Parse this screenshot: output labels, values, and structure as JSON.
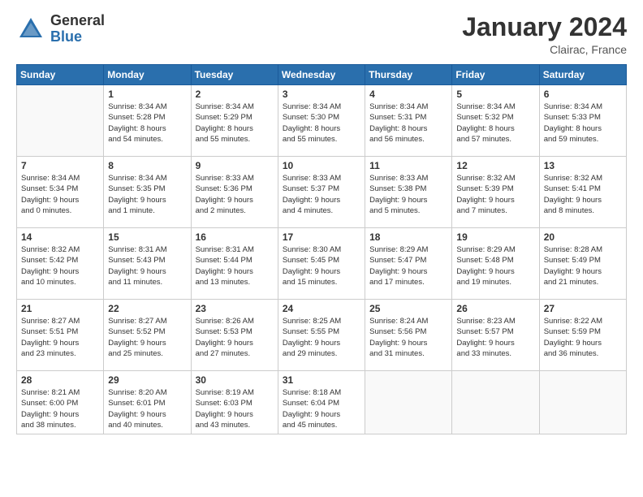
{
  "header": {
    "logo_general": "General",
    "logo_blue": "Blue",
    "month_title": "January 2024",
    "location": "Clairac, France"
  },
  "days_of_week": [
    "Sunday",
    "Monday",
    "Tuesday",
    "Wednesday",
    "Thursday",
    "Friday",
    "Saturday"
  ],
  "weeks": [
    [
      {
        "day": "",
        "info": ""
      },
      {
        "day": "1",
        "info": "Sunrise: 8:34 AM\nSunset: 5:28 PM\nDaylight: 8 hours\nand 54 minutes."
      },
      {
        "day": "2",
        "info": "Sunrise: 8:34 AM\nSunset: 5:29 PM\nDaylight: 8 hours\nand 55 minutes."
      },
      {
        "day": "3",
        "info": "Sunrise: 8:34 AM\nSunset: 5:30 PM\nDaylight: 8 hours\nand 55 minutes."
      },
      {
        "day": "4",
        "info": "Sunrise: 8:34 AM\nSunset: 5:31 PM\nDaylight: 8 hours\nand 56 minutes."
      },
      {
        "day": "5",
        "info": "Sunrise: 8:34 AM\nSunset: 5:32 PM\nDaylight: 8 hours\nand 57 minutes."
      },
      {
        "day": "6",
        "info": "Sunrise: 8:34 AM\nSunset: 5:33 PM\nDaylight: 8 hours\nand 59 minutes."
      }
    ],
    [
      {
        "day": "7",
        "info": "Sunrise: 8:34 AM\nSunset: 5:34 PM\nDaylight: 9 hours\nand 0 minutes."
      },
      {
        "day": "8",
        "info": "Sunrise: 8:34 AM\nSunset: 5:35 PM\nDaylight: 9 hours\nand 1 minute."
      },
      {
        "day": "9",
        "info": "Sunrise: 8:33 AM\nSunset: 5:36 PM\nDaylight: 9 hours\nand 2 minutes."
      },
      {
        "day": "10",
        "info": "Sunrise: 8:33 AM\nSunset: 5:37 PM\nDaylight: 9 hours\nand 4 minutes."
      },
      {
        "day": "11",
        "info": "Sunrise: 8:33 AM\nSunset: 5:38 PM\nDaylight: 9 hours\nand 5 minutes."
      },
      {
        "day": "12",
        "info": "Sunrise: 8:32 AM\nSunset: 5:39 PM\nDaylight: 9 hours\nand 7 minutes."
      },
      {
        "day": "13",
        "info": "Sunrise: 8:32 AM\nSunset: 5:41 PM\nDaylight: 9 hours\nand 8 minutes."
      }
    ],
    [
      {
        "day": "14",
        "info": "Sunrise: 8:32 AM\nSunset: 5:42 PM\nDaylight: 9 hours\nand 10 minutes."
      },
      {
        "day": "15",
        "info": "Sunrise: 8:31 AM\nSunset: 5:43 PM\nDaylight: 9 hours\nand 11 minutes."
      },
      {
        "day": "16",
        "info": "Sunrise: 8:31 AM\nSunset: 5:44 PM\nDaylight: 9 hours\nand 13 minutes."
      },
      {
        "day": "17",
        "info": "Sunrise: 8:30 AM\nSunset: 5:45 PM\nDaylight: 9 hours\nand 15 minutes."
      },
      {
        "day": "18",
        "info": "Sunrise: 8:29 AM\nSunset: 5:47 PM\nDaylight: 9 hours\nand 17 minutes."
      },
      {
        "day": "19",
        "info": "Sunrise: 8:29 AM\nSunset: 5:48 PM\nDaylight: 9 hours\nand 19 minutes."
      },
      {
        "day": "20",
        "info": "Sunrise: 8:28 AM\nSunset: 5:49 PM\nDaylight: 9 hours\nand 21 minutes."
      }
    ],
    [
      {
        "day": "21",
        "info": "Sunrise: 8:27 AM\nSunset: 5:51 PM\nDaylight: 9 hours\nand 23 minutes."
      },
      {
        "day": "22",
        "info": "Sunrise: 8:27 AM\nSunset: 5:52 PM\nDaylight: 9 hours\nand 25 minutes."
      },
      {
        "day": "23",
        "info": "Sunrise: 8:26 AM\nSunset: 5:53 PM\nDaylight: 9 hours\nand 27 minutes."
      },
      {
        "day": "24",
        "info": "Sunrise: 8:25 AM\nSunset: 5:55 PM\nDaylight: 9 hours\nand 29 minutes."
      },
      {
        "day": "25",
        "info": "Sunrise: 8:24 AM\nSunset: 5:56 PM\nDaylight: 9 hours\nand 31 minutes."
      },
      {
        "day": "26",
        "info": "Sunrise: 8:23 AM\nSunset: 5:57 PM\nDaylight: 9 hours\nand 33 minutes."
      },
      {
        "day": "27",
        "info": "Sunrise: 8:22 AM\nSunset: 5:59 PM\nDaylight: 9 hours\nand 36 minutes."
      }
    ],
    [
      {
        "day": "28",
        "info": "Sunrise: 8:21 AM\nSunset: 6:00 PM\nDaylight: 9 hours\nand 38 minutes."
      },
      {
        "day": "29",
        "info": "Sunrise: 8:20 AM\nSunset: 6:01 PM\nDaylight: 9 hours\nand 40 minutes."
      },
      {
        "day": "30",
        "info": "Sunrise: 8:19 AM\nSunset: 6:03 PM\nDaylight: 9 hours\nand 43 minutes."
      },
      {
        "day": "31",
        "info": "Sunrise: 8:18 AM\nSunset: 6:04 PM\nDaylight: 9 hours\nand 45 minutes."
      },
      {
        "day": "",
        "info": ""
      },
      {
        "day": "",
        "info": ""
      },
      {
        "day": "",
        "info": ""
      }
    ]
  ]
}
